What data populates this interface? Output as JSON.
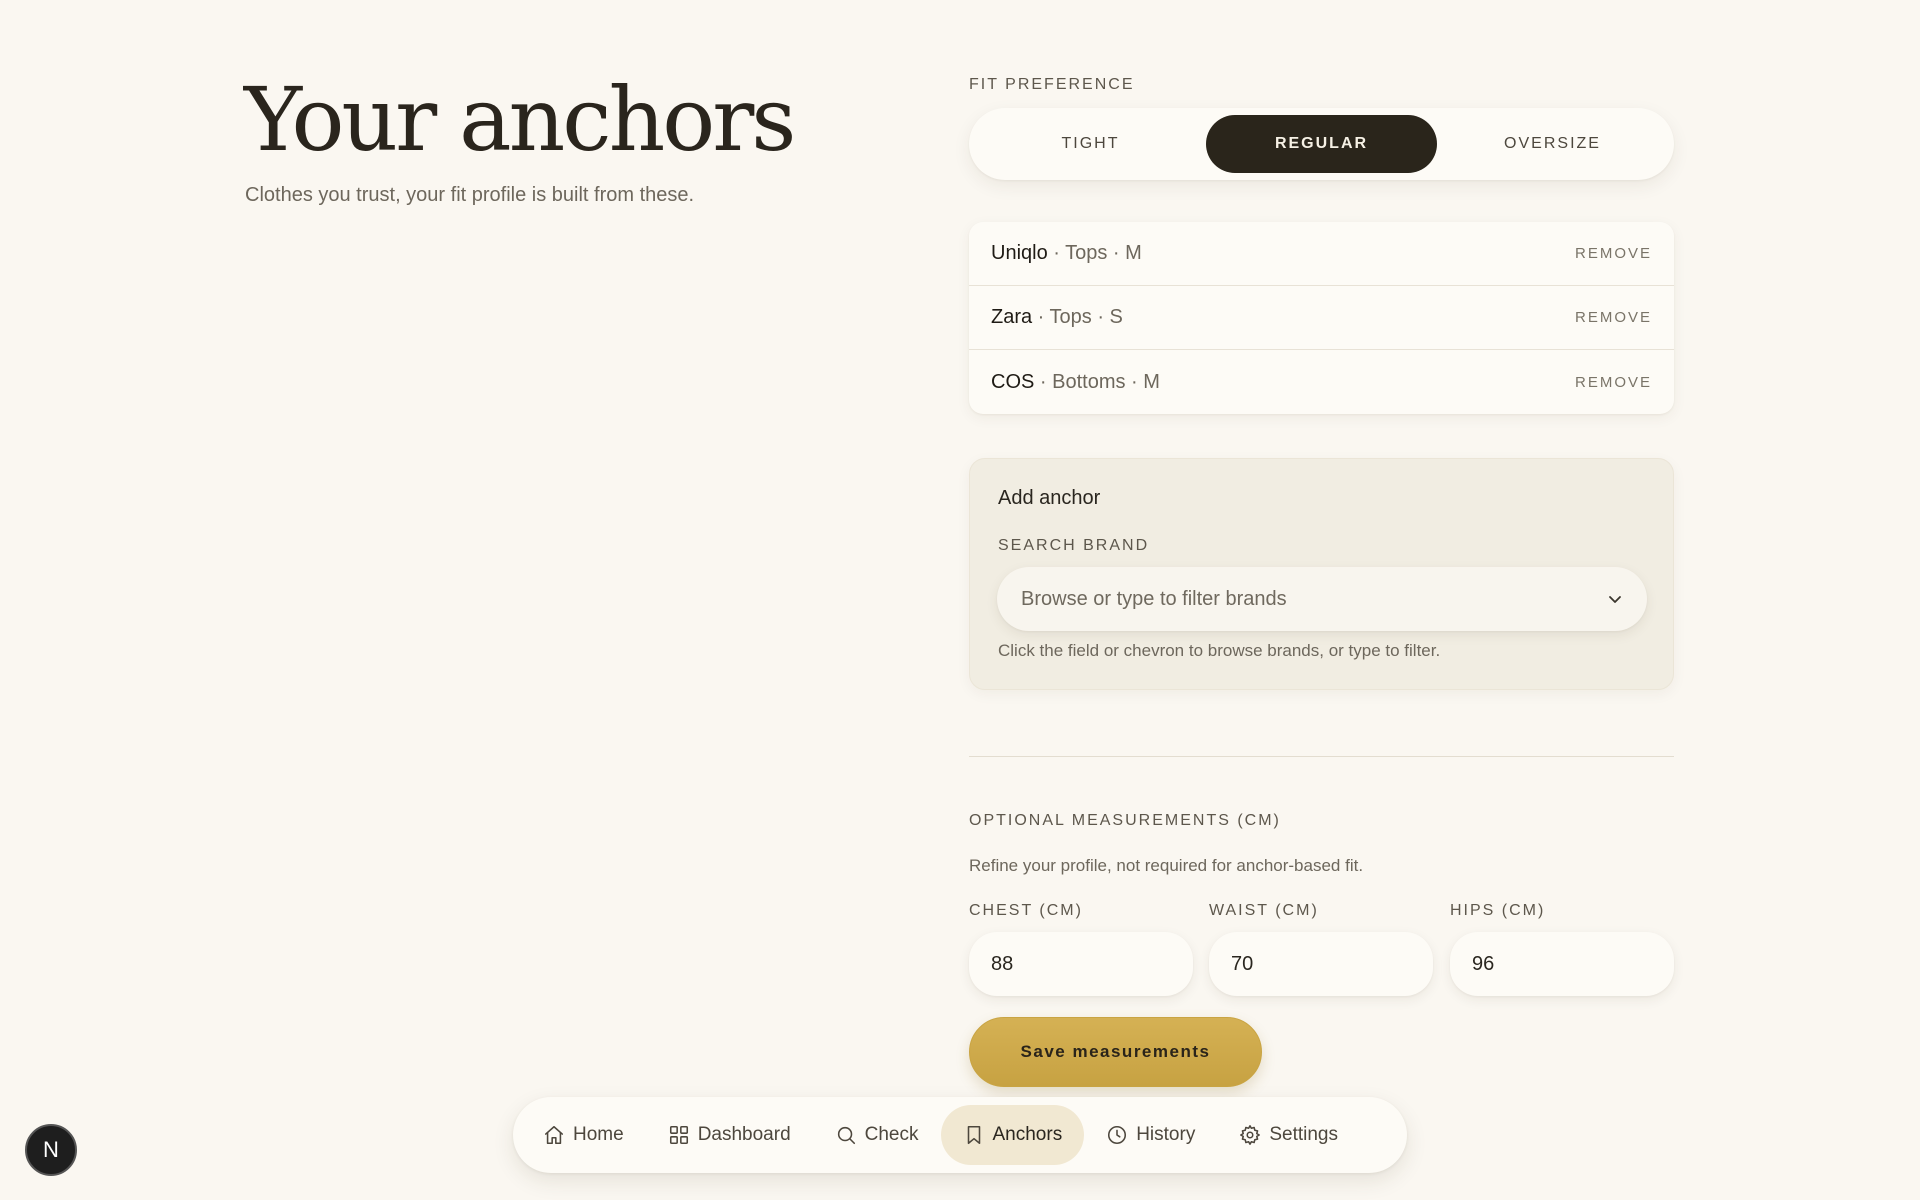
{
  "header": {
    "title": "Your anchors",
    "subtitle": "Clothes you trust, your fit profile is built from these."
  },
  "fit": {
    "label": "FIT PREFERENCE",
    "options": [
      "TIGHT",
      "REGULAR",
      "OVERSIZE"
    ],
    "selected": "REGULAR"
  },
  "anchors": [
    {
      "brand": "Uniqlo",
      "details": " · Tops · M",
      "remove": "REMOVE"
    },
    {
      "brand": "Zara",
      "details": " · Tops · S",
      "remove": "REMOVE"
    },
    {
      "brand": "COS",
      "details": " · Bottoms · M",
      "remove": "REMOVE"
    }
  ],
  "add_anchor": {
    "title": "Add anchor",
    "search_label": "SEARCH BRAND",
    "placeholder": "Browse or type to filter brands",
    "helper": "Click the field or chevron to browse brands, or type to filter."
  },
  "measurements": {
    "label": "OPTIONAL MEASUREMENTS (CM)",
    "description": "Refine your profile, not required for anchor-based fit.",
    "fields": [
      {
        "label": "CHEST (CM)",
        "value": "88"
      },
      {
        "label": "WAIST (CM)",
        "value": "70"
      },
      {
        "label": "HIPS (CM)",
        "value": "96"
      }
    ],
    "save_label": "Save measurements"
  },
  "nav": {
    "items": [
      {
        "label": "Home",
        "icon": "home-icon"
      },
      {
        "label": "Dashboard",
        "icon": "grid-icon"
      },
      {
        "label": "Check",
        "icon": "search-icon"
      },
      {
        "label": "Anchors",
        "icon": "bookmark-icon"
      },
      {
        "label": "History",
        "icon": "clock-icon"
      },
      {
        "label": "Settings",
        "icon": "gear-icon"
      }
    ],
    "active": "Anchors"
  },
  "badge": {
    "letter": "N"
  },
  "colors": {
    "background": "#faf7f1",
    "accent_dark": "#2a251b",
    "accent_gold": "#d5b154",
    "nav_active": "#f1e8d2"
  }
}
